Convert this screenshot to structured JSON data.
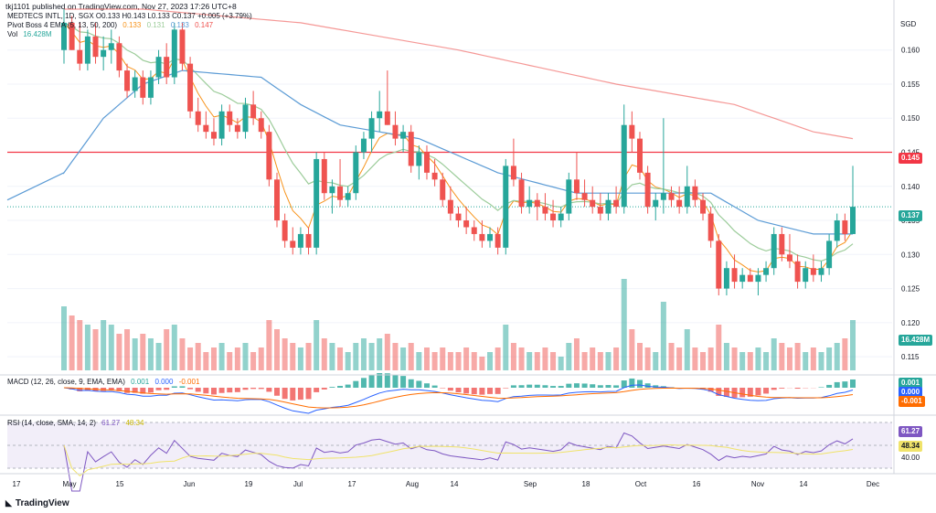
{
  "header": {
    "published_line": "tkj1101 published on TradingView.com, Nov 27, 2023 17:26 UTC+8"
  },
  "legend": {
    "symbol_line": "MEDTECS INTL, 1D, SGX  O0.133  H0.143  L0.133  C0.137  +0.005 (+3.79%)",
    "ema_name": "Pivot Boss 4 EMA (5, 13, 50, 200)",
    "ema_values": [
      "0.133",
      "0.131",
      "0.133",
      "0.147"
    ],
    "vol_name": "Vol",
    "vol_value": "16.428M",
    "macd_name": "MACD (12, 26, close, 9, EMA, EMA)",
    "macd_values": [
      "0.001",
      "0.000",
      "-0.001"
    ],
    "rsi_name": "RSI (14, close, SMA, 14, 2)",
    "rsi_values": [
      "61.27",
      "48.34"
    ]
  },
  "currency": "SGD",
  "colors": {
    "up": "#26a69a",
    "down": "#ef5350",
    "ema5": "#f7931a",
    "ema13": "#9ccc9a",
    "ema50": "#5b9bd5",
    "ema200": "#ef5350",
    "hline": "#f23645",
    "macd_line": "#2962ff",
    "signal_line": "#ff6d00",
    "rsi_line": "#7e57c2",
    "rsi_ma": "#f0e36a",
    "rsi_band": "#ede7f6"
  },
  "badges": {
    "hline": "0.145",
    "last_price": "0.137",
    "volume": "16.428M",
    "macd": "0.001",
    "signal": "0.000",
    "hist": "-0.001",
    "rsi": "61.27",
    "rsi_ma": "48.34"
  },
  "footer": {
    "logo_text": "TradingView"
  },
  "chart_data": [
    {
      "type": "candlestick",
      "title": "MEDTECS INTL, 1D, SGX",
      "x_tick_labels": [
        "17",
        "May",
        "15",
        "Jun",
        "19",
        "Jul",
        "17",
        "Aug",
        "14",
        "Sep",
        "18",
        "Oct",
        "16",
        "Nov",
        "14",
        "Dec"
      ],
      "y_tick_labels": [
        "0.160",
        "0.155",
        "0.150",
        "0.145",
        "0.140",
        "0.135",
        "0.130",
        "0.125",
        "0.120",
        "0.115"
      ],
      "ylim": [
        0.113,
        0.166
      ],
      "horizontal_line": 0.145,
      "candles": [
        [
          0.16,
          0.166,
          0.158,
          0.164
        ],
        [
          0.164,
          0.165,
          0.16,
          0.16
        ],
        [
          0.16,
          0.164,
          0.157,
          0.158
        ],
        [
          0.158,
          0.163,
          0.157,
          0.162
        ],
        [
          0.162,
          0.164,
          0.158,
          0.159
        ],
        [
          0.159,
          0.162,
          0.157,
          0.16
        ],
        [
          0.16,
          0.163,
          0.158,
          0.161
        ],
        [
          0.161,
          0.162,
          0.156,
          0.157
        ],
        [
          0.157,
          0.158,
          0.153,
          0.154
        ],
        [
          0.154,
          0.157,
          0.153,
          0.156
        ],
        [
          0.156,
          0.157,
          0.152,
          0.153
        ],
        [
          0.153,
          0.157,
          0.152,
          0.156
        ],
        [
          0.156,
          0.16,
          0.155,
          0.159
        ],
        [
          0.159,
          0.161,
          0.155,
          0.156
        ],
        [
          0.156,
          0.164,
          0.155,
          0.163
        ],
        [
          0.163,
          0.164,
          0.157,
          0.158
        ],
        [
          0.158,
          0.159,
          0.15,
          0.151
        ],
        [
          0.151,
          0.153,
          0.148,
          0.149
        ],
        [
          0.149,
          0.151,
          0.147,
          0.148
        ],
        [
          0.148,
          0.15,
          0.146,
          0.147
        ],
        [
          0.147,
          0.152,
          0.146,
          0.151
        ],
        [
          0.151,
          0.152,
          0.148,
          0.149
        ],
        [
          0.149,
          0.15,
          0.147,
          0.148
        ],
        [
          0.148,
          0.153,
          0.147,
          0.152
        ],
        [
          0.152,
          0.154,
          0.149,
          0.15
        ],
        [
          0.15,
          0.151,
          0.147,
          0.148
        ],
        [
          0.148,
          0.149,
          0.14,
          0.141
        ],
        [
          0.141,
          0.142,
          0.134,
          0.135
        ],
        [
          0.135,
          0.136,
          0.131,
          0.132
        ],
        [
          0.132,
          0.134,
          0.13,
          0.131
        ],
        [
          0.131,
          0.134,
          0.13,
          0.133
        ],
        [
          0.133,
          0.134,
          0.13,
          0.131
        ],
        [
          0.131,
          0.145,
          0.13,
          0.144
        ],
        [
          0.144,
          0.145,
          0.138,
          0.139
        ],
        [
          0.139,
          0.141,
          0.136,
          0.14
        ],
        [
          0.14,
          0.144,
          0.137,
          0.138
        ],
        [
          0.138,
          0.14,
          0.137,
          0.139
        ],
        [
          0.139,
          0.146,
          0.138,
          0.145
        ],
        [
          0.145,
          0.148,
          0.144,
          0.147
        ],
        [
          0.147,
          0.151,
          0.145,
          0.15
        ],
        [
          0.15,
          0.154,
          0.148,
          0.151
        ],
        [
          0.151,
          0.157,
          0.149,
          0.149
        ],
        [
          0.149,
          0.151,
          0.146,
          0.147
        ],
        [
          0.147,
          0.149,
          0.145,
          0.148
        ],
        [
          0.148,
          0.149,
          0.142,
          0.143
        ],
        [
          0.143,
          0.146,
          0.141,
          0.145
        ],
        [
          0.145,
          0.146,
          0.141,
          0.142
        ],
        [
          0.142,
          0.144,
          0.14,
          0.141
        ],
        [
          0.141,
          0.142,
          0.137,
          0.138
        ],
        [
          0.138,
          0.14,
          0.135,
          0.136
        ],
        [
          0.136,
          0.137,
          0.134,
          0.135
        ],
        [
          0.135,
          0.137,
          0.133,
          0.134
        ],
        [
          0.134,
          0.135,
          0.132,
          0.133
        ],
        [
          0.133,
          0.135,
          0.131,
          0.132
        ],
        [
          0.132,
          0.134,
          0.131,
          0.133
        ],
        [
          0.133,
          0.134,
          0.13,
          0.131
        ],
        [
          0.131,
          0.144,
          0.13,
          0.143
        ],
        [
          0.143,
          0.147,
          0.14,
          0.141
        ],
        [
          0.141,
          0.142,
          0.136,
          0.137
        ],
        [
          0.137,
          0.14,
          0.136,
          0.138
        ],
        [
          0.138,
          0.139,
          0.135,
          0.137
        ],
        [
          0.137,
          0.139,
          0.135,
          0.136
        ],
        [
          0.136,
          0.138,
          0.134,
          0.135
        ],
        [
          0.135,
          0.137,
          0.134,
          0.136
        ],
        [
          0.136,
          0.142,
          0.135,
          0.141
        ],
        [
          0.141,
          0.145,
          0.138,
          0.139
        ],
        [
          0.139,
          0.141,
          0.137,
          0.138
        ],
        [
          0.138,
          0.14,
          0.136,
          0.137
        ],
        [
          0.137,
          0.139,
          0.135,
          0.136
        ],
        [
          0.136,
          0.139,
          0.135,
          0.138
        ],
        [
          0.138,
          0.14,
          0.136,
          0.137
        ],
        [
          0.137,
          0.152,
          0.136,
          0.149
        ],
        [
          0.149,
          0.151,
          0.145,
          0.147
        ],
        [
          0.147,
          0.148,
          0.141,
          0.142
        ],
        [
          0.142,
          0.143,
          0.136,
          0.137
        ],
        [
          0.137,
          0.139,
          0.135,
          0.138
        ],
        [
          0.138,
          0.15,
          0.136,
          0.139
        ],
        [
          0.139,
          0.14,
          0.137,
          0.138
        ],
        [
          0.138,
          0.14,
          0.136,
          0.137
        ],
        [
          0.137,
          0.143,
          0.136,
          0.14
        ],
        [
          0.14,
          0.141,
          0.137,
          0.138
        ],
        [
          0.138,
          0.139,
          0.135,
          0.136
        ],
        [
          0.136,
          0.137,
          0.131,
          0.132
        ],
        [
          0.132,
          0.133,
          0.124,
          0.125
        ],
        [
          0.125,
          0.129,
          0.124,
          0.128
        ],
        [
          0.128,
          0.13,
          0.125,
          0.126
        ],
        [
          0.126,
          0.128,
          0.125,
          0.127
        ],
        [
          0.127,
          0.128,
          0.126,
          0.126
        ],
        [
          0.126,
          0.128,
          0.124,
          0.127
        ],
        [
          0.127,
          0.129,
          0.126,
          0.128
        ],
        [
          0.128,
          0.134,
          0.127,
          0.133
        ],
        [
          0.133,
          0.134,
          0.129,
          0.13
        ],
        [
          0.13,
          0.133,
          0.128,
          0.129
        ],
        [
          0.129,
          0.13,
          0.125,
          0.126
        ],
        [
          0.126,
          0.129,
          0.125,
          0.128
        ],
        [
          0.128,
          0.13,
          0.126,
          0.127
        ],
        [
          0.127,
          0.129,
          0.126,
          0.128
        ],
        [
          0.128,
          0.133,
          0.127,
          0.132
        ],
        [
          0.132,
          0.136,
          0.131,
          0.135
        ],
        [
          0.135,
          0.136,
          0.132,
          0.133
        ],
        [
          0.133,
          0.143,
          0.133,
          0.137
        ]
      ],
      "volume": [
        0.7,
        0.6,
        0.55,
        0.5,
        0.45,
        0.55,
        0.5,
        0.4,
        0.45,
        0.35,
        0.4,
        0.35,
        0.3,
        0.45,
        0.5,
        0.35,
        0.25,
        0.3,
        0.2,
        0.25,
        0.3,
        0.2,
        0.25,
        0.3,
        0.2,
        0.25,
        0.55,
        0.45,
        0.35,
        0.3,
        0.25,
        0.3,
        0.55,
        0.35,
        0.3,
        0.25,
        0.2,
        0.3,
        0.35,
        0.3,
        0.35,
        0.4,
        0.3,
        0.25,
        0.3,
        0.2,
        0.25,
        0.2,
        0.25,
        0.2,
        0.2,
        0.25,
        0.2,
        0.15,
        0.2,
        0.25,
        0.5,
        0.3,
        0.25,
        0.2,
        0.2,
        0.25,
        0.2,
        0.15,
        0.3,
        0.35,
        0.2,
        0.25,
        0.2,
        0.2,
        0.25,
        1.0,
        0.45,
        0.3,
        0.25,
        0.2,
        0.75,
        0.3,
        0.25,
        0.45,
        0.25,
        0.2,
        0.25,
        0.5,
        0.3,
        0.25,
        0.2,
        0.2,
        0.25,
        0.2,
        0.35,
        0.3,
        0.25,
        0.3,
        0.2,
        0.25,
        0.2,
        0.25,
        0.3,
        0.35,
        0.55
      ],
      "ema200": [
        [
          0,
          0.166
        ],
        [
          10,
          0.166
        ],
        [
          30,
          0.164
        ],
        [
          50,
          0.16
        ],
        [
          70,
          0.155
        ],
        [
          85,
          0.152
        ],
        [
          95,
          0.148
        ],
        [
          100,
          0.147
        ]
      ],
      "ema50": [
        [
          0,
          0.142
        ],
        [
          5,
          0.15
        ],
        [
          10,
          0.155
        ],
        [
          15,
          0.157
        ],
        [
          25,
          0.156
        ],
        [
          30,
          0.152
        ],
        [
          35,
          0.149
        ],
        [
          45,
          0.147
        ],
        [
          55,
          0.142
        ],
        [
          65,
          0.139
        ],
        [
          75,
          0.139
        ],
        [
          82,
          0.139
        ],
        [
          88,
          0.135
        ],
        [
          95,
          0.133
        ],
        [
          100,
          0.133
        ]
      ]
    },
    {
      "type": "bar",
      "title": "MACD (12, 26, close, 9, EMA, EMA)",
      "values": [
        0.001,
        0.0,
        -0.001
      ]
    },
    {
      "type": "line",
      "title": "RSI (14, close, SMA, 14, 2)",
      "values": [
        61.27,
        48.34
      ],
      "y_tick_labels": [
        "40.00"
      ]
    }
  ]
}
